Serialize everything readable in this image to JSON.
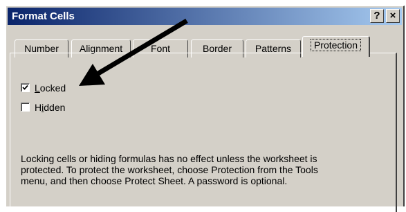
{
  "window": {
    "title": "Format Cells",
    "help_label": "?",
    "close_label": "×"
  },
  "tabs": [
    {
      "label": "Number",
      "active": false
    },
    {
      "label": "Alignment",
      "active": false
    },
    {
      "label": "Font",
      "active": false
    },
    {
      "label": "Border",
      "active": false
    },
    {
      "label": "Patterns",
      "active": false
    },
    {
      "label": "Protection",
      "active": true
    }
  ],
  "protection": {
    "locked": {
      "label_before": "",
      "accel": "L",
      "label_after": "ocked",
      "checked": true
    },
    "hidden": {
      "label_before": "H",
      "accel": "i",
      "label_after": "dden",
      "checked": false
    },
    "description": "Locking cells or hiding formulas has no effect unless the worksheet is protected. To protect the worksheet, choose Protection from the Tools menu, and then choose Protect Sheet. A password is optional."
  },
  "annotation": {
    "arrow_color": "#000000"
  }
}
